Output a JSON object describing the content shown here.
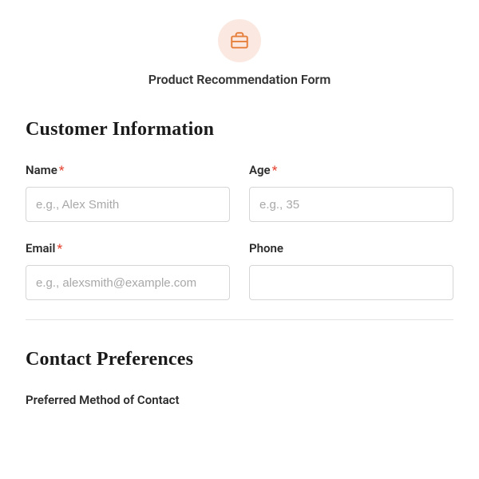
{
  "header": {
    "title": "Product Recommendation Form"
  },
  "section1": {
    "heading": "Customer Information",
    "name_label": "Name",
    "name_placeholder": "e.g., Alex Smith",
    "age_label": "Age",
    "age_placeholder": "e.g., 35",
    "email_label": "Email",
    "email_placeholder": "e.g., alexsmith@example.com",
    "phone_label": "Phone",
    "required_mark": "*"
  },
  "section2": {
    "heading": "Contact Preferences",
    "pref_label": "Preferred Method of Contact"
  }
}
